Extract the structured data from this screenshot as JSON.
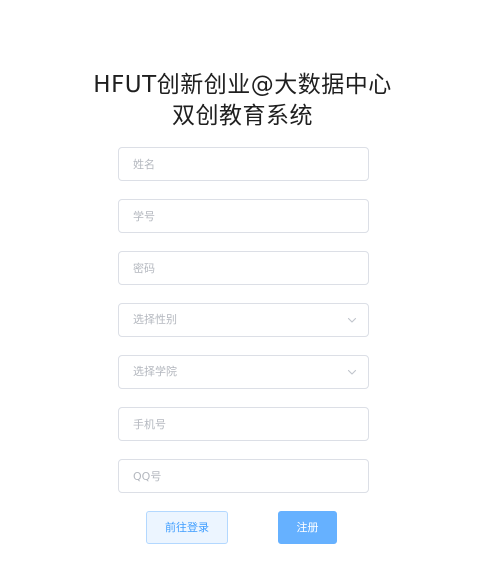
{
  "header": {
    "title_line1": "HFUT创新创业@大数据中心",
    "title_line2": "双创教育系统"
  },
  "form": {
    "name": {
      "placeholder": "姓名",
      "value": ""
    },
    "student_id": {
      "placeholder": "学号",
      "value": ""
    },
    "password": {
      "placeholder": "密码",
      "value": ""
    },
    "gender": {
      "placeholder": "选择性别",
      "icon": "chevron-down-icon"
    },
    "college": {
      "placeholder": "选择学院",
      "icon": "chevron-down-icon"
    },
    "phone": {
      "placeholder": "手机号",
      "value": ""
    },
    "qq": {
      "placeholder": "QQ号",
      "value": ""
    }
  },
  "actions": {
    "login_label": "前往登录",
    "register_label": "注册"
  },
  "colors": {
    "primary": "#409eff",
    "primary_light_bg": "#ecf5ff",
    "primary_light_border": "#b3d8ff",
    "register_bg": "#66b1ff",
    "input_border": "#dcdfe6",
    "placeholder": "#b4b8bf"
  }
}
